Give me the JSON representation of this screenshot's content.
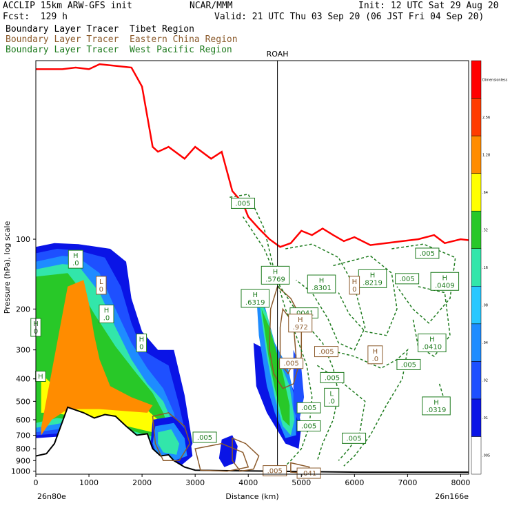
{
  "header": {
    "model": "ACCLIP 15km ARW-GFS init",
    "org": "NCAR/MMM",
    "init": "Init: 12 UTC Sat 29 Aug 20",
    "fcst": "Fcst:  129 h",
    "valid": "Valid: 21 UTC Thu 03 Sep 20 (06 JST Fri 04 Sep 20)"
  },
  "tracers": [
    {
      "label": "Boundary Layer Tracer  Tibet Region",
      "color": "#000000"
    },
    {
      "label": "Boundary Layer Tracer  Eastern China Region",
      "color": "#8B5A2B"
    },
    {
      "label": "Boundary Layer Tracer  West Pacific Region",
      "color": "#1E7B1E"
    }
  ],
  "chart_data": {
    "type": "heatmap",
    "title": "",
    "xlabel": "Distance (km)",
    "ylabel": "Pressure (hPa), log scale",
    "xlim": [
      0,
      8150
    ],
    "ylim_hpa": [
      1030,
      17
    ],
    "y_scale": "log",
    "x_ticks": [
      0,
      1000,
      2000,
      3000,
      4000,
      5000,
      6000,
      7000,
      8000
    ],
    "y_ticks": [
      100,
      200,
      300,
      400,
      500,
      600,
      700,
      800,
      900,
      1000
    ],
    "left_end": "26n80e",
    "right_end": "26n166e",
    "vertical_marker": {
      "label": "ROAH",
      "x_km": 4550
    },
    "colorbar": {
      "levels": [
        "0.005",
        ".01",
        ".02",
        ".04",
        ".08",
        ".16",
        ".32",
        ".64",
        "1.28",
        "2.56",
        "5.12"
      ],
      "printed_labels": [
        ".005",
        ".01",
        ".02",
        ".04",
        ".08",
        ".16",
        ".32",
        ".64",
        "1.28",
        "2.56",
        "Dimensionless"
      ],
      "colors": [
        "#ffffff",
        "#0a14e6",
        "#1e50ff",
        "#1e8cff",
        "#28c8ff",
        "#32e6aa",
        "#28c828",
        "#ffff00",
        "#ff8c00",
        "#ff3c00",
        "#ff0000"
      ]
    },
    "tropopause_color": "#ff0000",
    "terrain_color": "#000000",
    "annotations_green": [
      {
        "text": "H\n.0",
        "x_km": 750,
        "p_hpa": 122
      },
      {
        "text": "H\n.0",
        "x_km": 1330,
        "p_hpa": 210
      },
      {
        "text": "H\n0",
        "x_km": 0,
        "p_hpa": 240
      },
      {
        "text": "H\n0",
        "x_km": 1990,
        "p_hpa": 280
      },
      {
        "text": "H",
        "x_km": 90,
        "p_hpa": 390
      },
      {
        "text": "H\n.5769",
        "x_km": 4510,
        "p_hpa": 143
      },
      {
        "text": "H\n.6319",
        "x_km": 4130,
        "p_hpa": 180
      },
      {
        "text": "H\n.8301",
        "x_km": 5380,
        "p_hpa": 156
      },
      {
        "text": "H\n.8219",
        "x_km": 6340,
        "p_hpa": 148
      },
      {
        "text": ".005",
        "x_km": 6990,
        "p_hpa": 148
      },
      {
        "text": ".005",
        "x_km": 7370,
        "p_hpa": 115
      },
      {
        "text": "H\n.0409",
        "x_km": 7700,
        "p_hpa": 152
      },
      {
        "text": ".0041",
        "x_km": 5050,
        "p_hpa": 208
      },
      {
        "text": "H\n.0410",
        "x_km": 7460,
        "p_hpa": 280
      },
      {
        "text": ".005",
        "x_km": 7020,
        "p_hpa": 347
      },
      {
        "text": ".005",
        "x_km": 5580,
        "p_hpa": 395
      },
      {
        "text": "L\n.0",
        "x_km": 5570,
        "p_hpa": 480
      },
      {
        "text": ".005",
        "x_km": 5140,
        "p_hpa": 533
      },
      {
        "text": ".005",
        "x_km": 5140,
        "p_hpa": 638
      },
      {
        "text": ".005",
        "x_km": 5990,
        "p_hpa": 721
      },
      {
        "text": "H\n.0319",
        "x_km": 7540,
        "p_hpa": 523
      },
      {
        "text": ".005",
        "x_km": 3900,
        "p_hpa": 70
      },
      {
        "text": ".005",
        "x_km": 3180,
        "p_hpa": 714
      }
    ],
    "annotations_brown": [
      {
        "text": "L\n0",
        "x_km": 1230,
        "p_hpa": 158
      },
      {
        "text": "H\n0",
        "x_km": 6000,
        "p_hpa": 158
      },
      {
        "text": "H\n.972",
        "x_km": 4980,
        "p_hpa": 230
      },
      {
        "text": "H\n.0",
        "x_km": 6390,
        "p_hpa": 315
      },
      {
        "text": ".005",
        "x_km": 5470,
        "p_hpa": 305
      },
      {
        "text": ".005",
        "x_km": 4810,
        "p_hpa": 343
      },
      {
        "text": ".005",
        "x_km": 4500,
        "p_hpa": 996
      },
      {
        "text": ".041",
        "x_km": 5140,
        "p_hpa": 1020
      }
    ]
  }
}
